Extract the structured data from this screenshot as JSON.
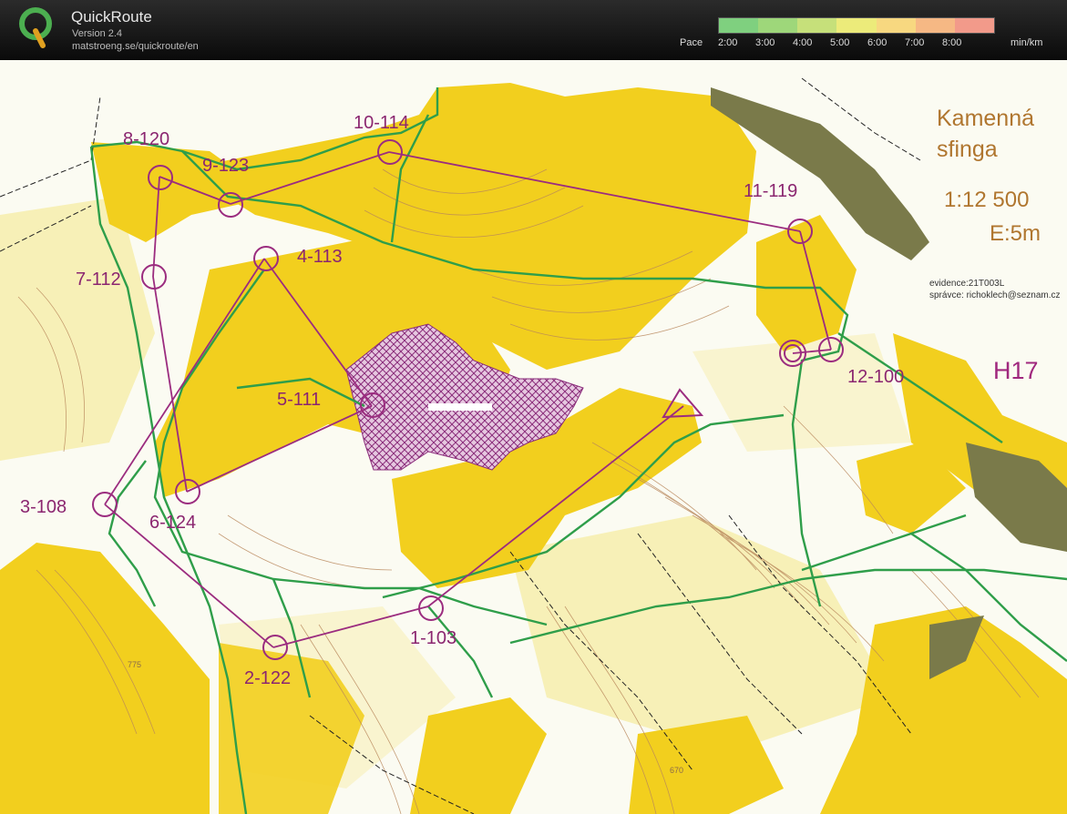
{
  "app": {
    "title": "QuickRoute",
    "version": "Version 2.4",
    "url": "matstroeng.se/quickroute/en"
  },
  "pace_scale": {
    "label": "Pace",
    "ticks": [
      "2:00",
      "3:00",
      "4:00",
      "5:00",
      "6:00",
      "7:00",
      "8:00"
    ],
    "unit": "min/km",
    "colors": [
      "#7fd07f",
      "#9ed77a",
      "#c6e07a",
      "#eceb7a",
      "#f7d880",
      "#f6b884",
      "#f29a8a"
    ]
  },
  "map": {
    "title_line1": "Kamenná",
    "title_line2": "sfinga",
    "scale": "1:12 500",
    "contour": "E:5m",
    "evidence": "evidence:21T003L",
    "admin": "správce: richoklech@seznam.cz",
    "category": "H17",
    "controls": [
      {
        "label": "1-103"
      },
      {
        "label": "2-122"
      },
      {
        "label": "3-108"
      },
      {
        "label": "4-113"
      },
      {
        "label": "5-111"
      },
      {
        "label": "6-124"
      },
      {
        "label": "7-112"
      },
      {
        "label": "8-120"
      },
      {
        "label": "9-123"
      },
      {
        "label": "10-114"
      },
      {
        "label": "11-119"
      },
      {
        "label": "12-100"
      }
    ],
    "spot_heights": [
      "775",
      "670"
    ],
    "colors": {
      "forest_yellow": "#f2cf1e",
      "light_yellow": "#f7eaa0",
      "course_purple": "#9b2c7f",
      "route_green": "#2f9e4a",
      "contour_brown": "#b8865a"
    }
  }
}
